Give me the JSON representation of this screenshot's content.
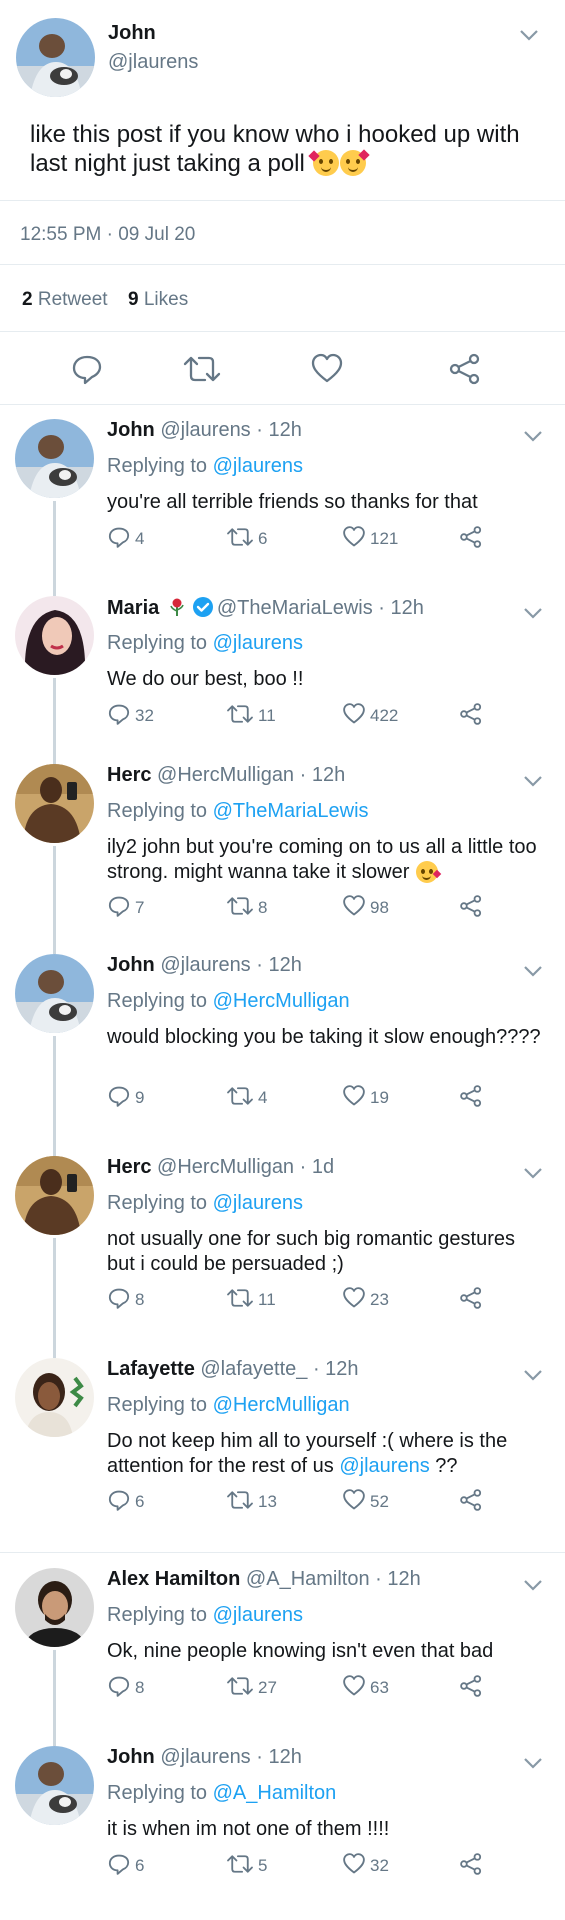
{
  "main_tweet": {
    "name": "John",
    "handle": "@jlaurens",
    "text": "like this post if you know who i hooked up with last night just taking a poll",
    "emoji": "smiling-face-with-hearts",
    "timestamp": "12:55 PM · 09 Jul 20",
    "retweets_count": "2",
    "retweets_label": "Retweet",
    "likes_count": "9",
    "likes_label": "Likes"
  },
  "replies": [
    {
      "name": "John",
      "handle": "@jlaurens",
      "time": "· 12h",
      "replying_prefix": "Replying to",
      "replying_to": "@jlaurens",
      "text": "you're all terrible friends so thanks for that",
      "comments": "4",
      "retweets": "6",
      "likes": "121"
    },
    {
      "name": "Maria",
      "badge": "rose-emoji",
      "verified": true,
      "handle": "@TheMariaLewis",
      "time": "· 12h",
      "replying_prefix": "Replying to",
      "replying_to": "@jlaurens",
      "text": "We do our best, boo !!",
      "comments": "32",
      "retweets": "11",
      "likes": "422"
    },
    {
      "name": "Herc",
      "handle": "@HercMulligan",
      "time": "· 12h",
      "replying_prefix": "Replying to",
      "replying_to": "@TheMariaLewis",
      "text": "ily2 john but you're coming on to us all a little too strong. might wanna take it slower",
      "emoji": "face-blowing-kiss",
      "comments": "7",
      "retweets": "8",
      "likes": "98"
    },
    {
      "name": "John",
      "handle": "@jlaurens",
      "time": "· 12h",
      "replying_prefix": "Replying to",
      "replying_to": "@HercMulligan",
      "text": "would blocking you be taking it slow enough????",
      "comments": "9",
      "retweets": "4",
      "likes": "19"
    },
    {
      "name": "Herc",
      "handle": "@HercMulligan",
      "time": "· 1d",
      "replying_prefix": "Replying to",
      "replying_to": "@jlaurens",
      "text": "not usually one for such big romantic gestures but i could be persuaded ;)",
      "comments": "8",
      "retweets": "11",
      "likes": "23"
    },
    {
      "name": "Lafayette",
      "handle": "@lafayette_",
      "time": "· 12h",
      "replying_prefix": "Replying to",
      "replying_to": "@HercMulligan",
      "text": "Do not keep him all to yourself :( where is the attention for the rest of us",
      "text_mention": "@jlaurens",
      "text_suffix": "??",
      "comments": "6",
      "retweets": "13",
      "likes": "52"
    },
    {
      "name": "Alex Hamilton",
      "handle": "@A_Hamilton",
      "time": "· 12h",
      "replying_prefix": "Replying to",
      "replying_to": "@jlaurens",
      "text": "Ok, nine people knowing isn't even that bad",
      "comments": "8",
      "retweets": "27",
      "likes": "63"
    },
    {
      "name": "John",
      "handle": "@jlaurens",
      "time": "· 12h",
      "replying_prefix": "Replying to",
      "replying_to": "@A_Hamilton",
      "text": "it is when im not one of them !!!!",
      "comments": "6",
      "retweets": "5",
      "likes": "32"
    }
  ],
  "colors": {
    "accent": "#1da1f2",
    "secondary_text": "#657786",
    "primary_text": "#14171a",
    "border": "#e6ecf0",
    "thread_line": "#ccd6dd",
    "verified": "#1da1f2"
  }
}
